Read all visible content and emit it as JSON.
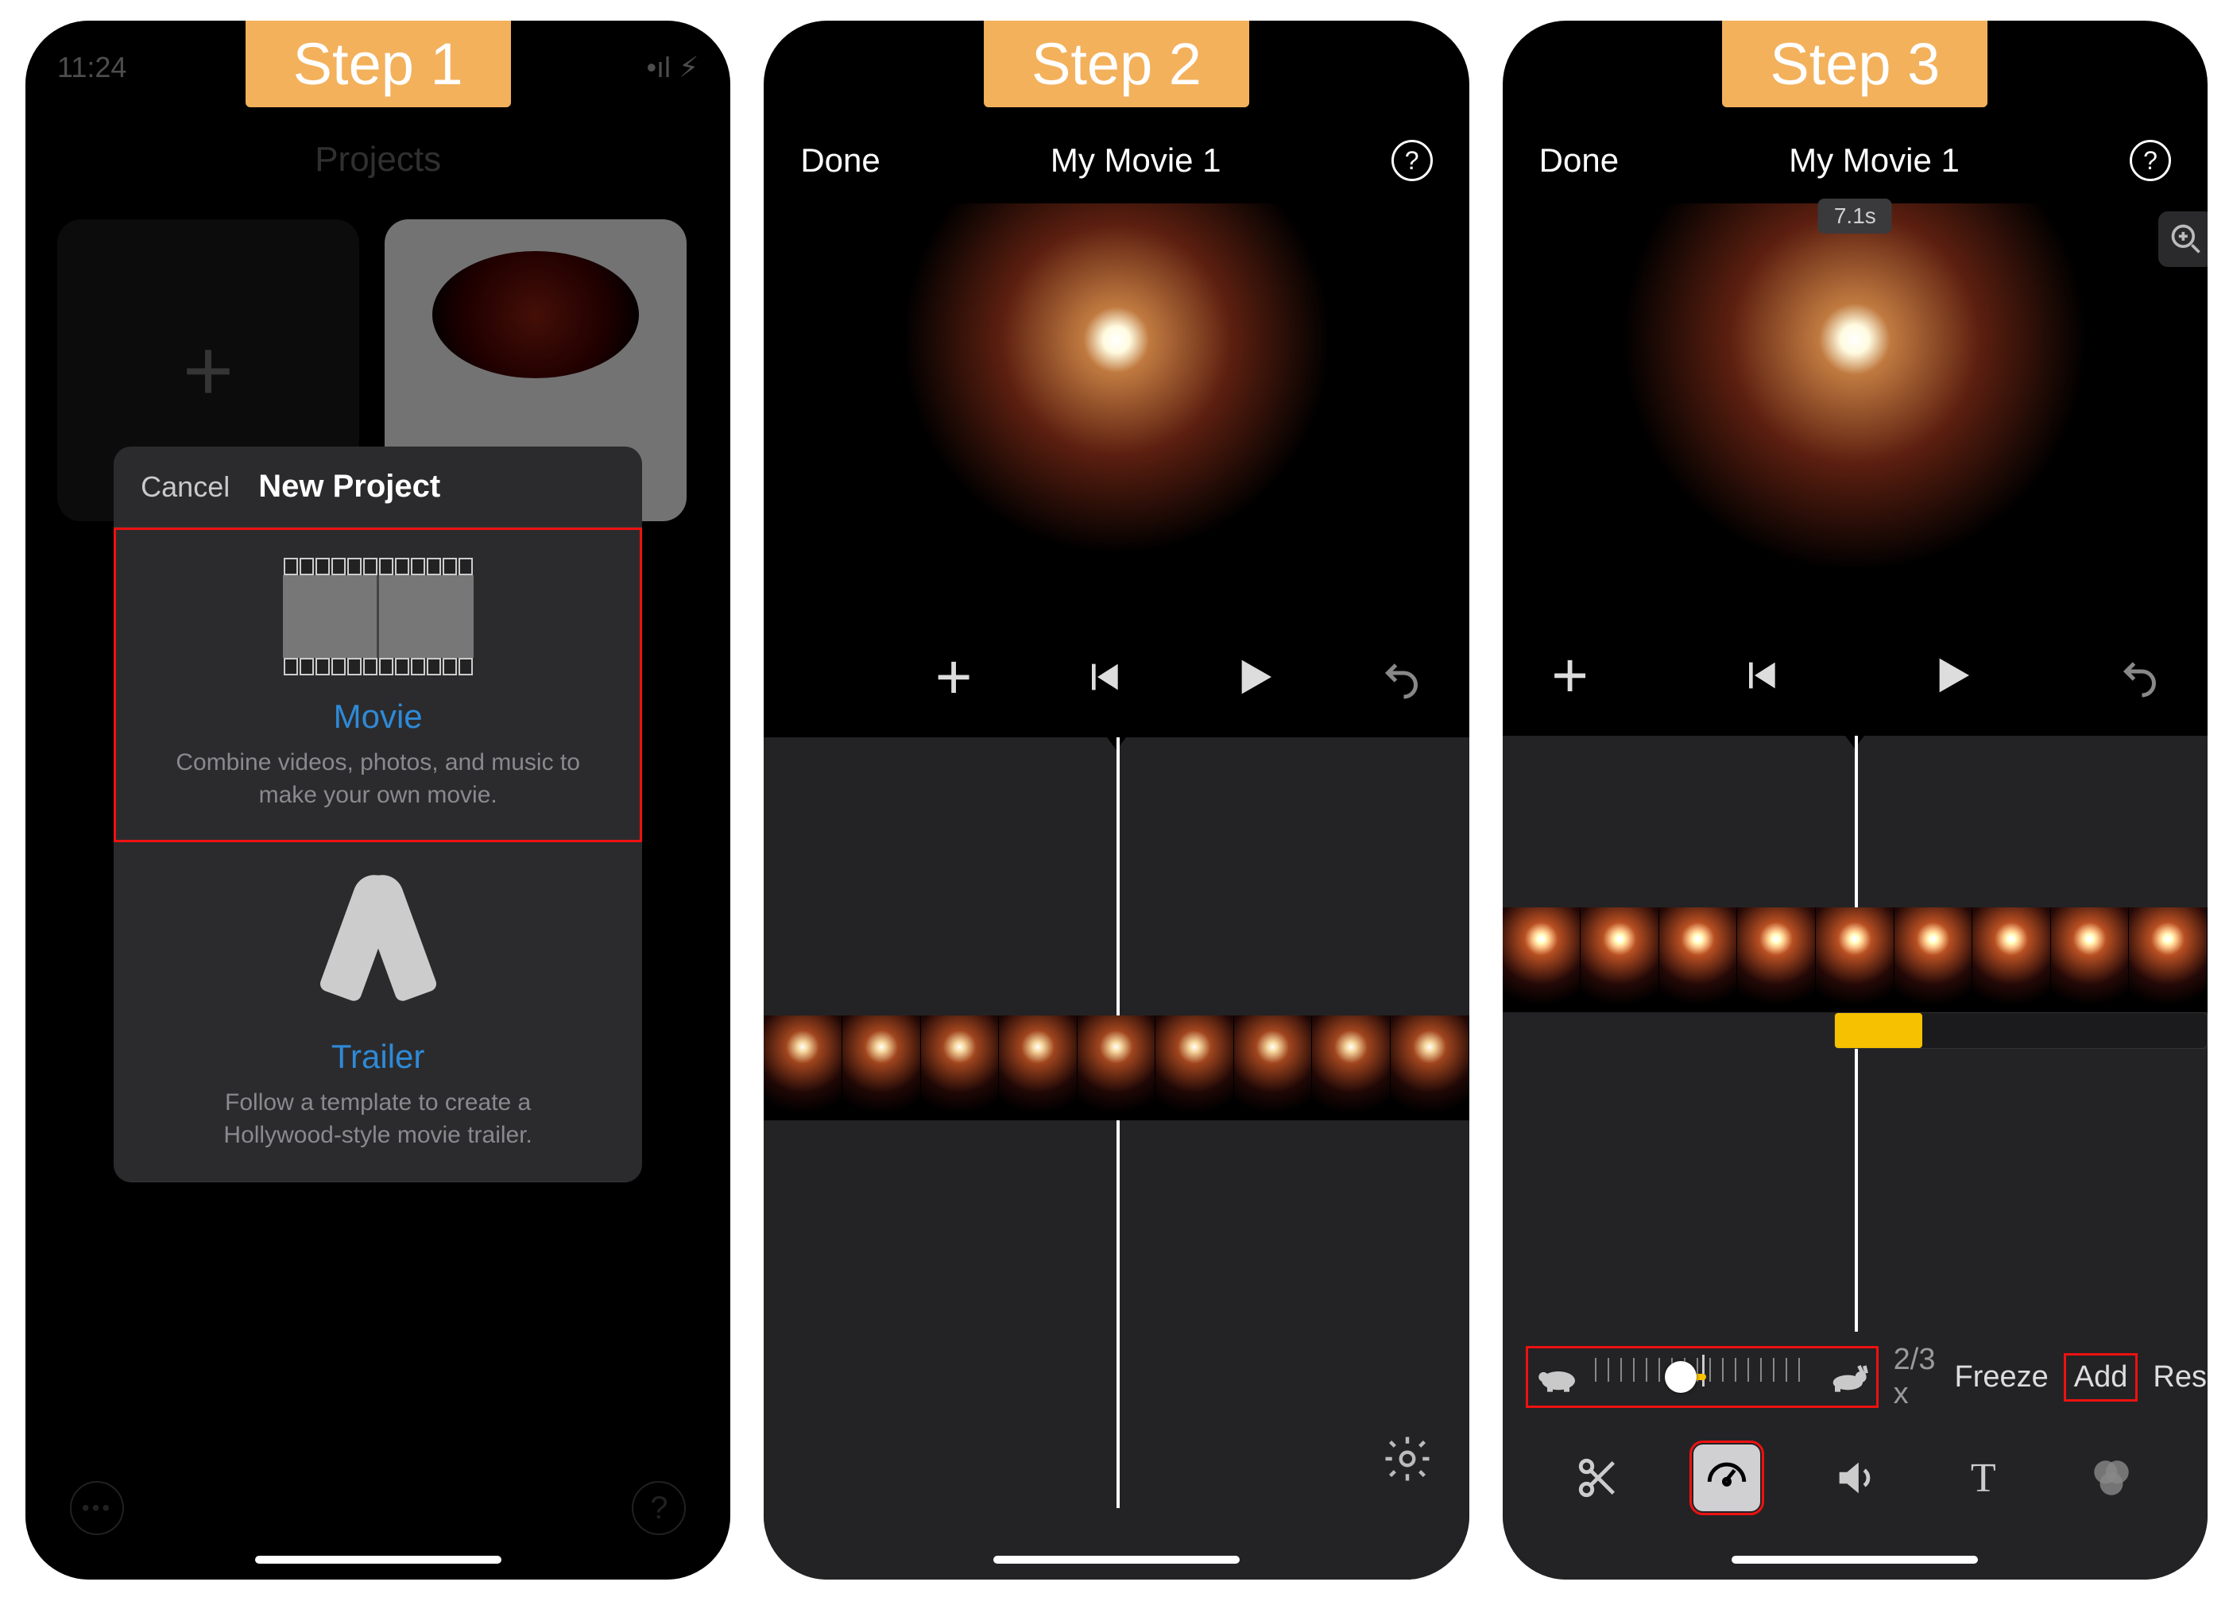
{
  "steps": {
    "s1": "Step 1",
    "s2": "Step 2",
    "s3": "Step 3"
  },
  "step1": {
    "status_time": "11:24",
    "projects_title": "Projects",
    "sheet": {
      "cancel": "Cancel",
      "title": "New Project",
      "movie": {
        "label": "Movie",
        "desc": "Combine videos, photos, and music to make your own movie."
      },
      "trailer": {
        "label": "Trailer",
        "desc": "Follow a template to create a Hollywood-style movie trailer."
      }
    },
    "help_glyph": "?"
  },
  "step2": {
    "done": "Done",
    "title": "My Movie 1",
    "help_glyph": "?"
  },
  "step3": {
    "done": "Done",
    "title": "My Movie 1",
    "help_glyph": "?",
    "time_pill": "7.1s",
    "speed_value": "2/3 x",
    "freeze": "Freeze",
    "add": "Add",
    "reset": "Reset",
    "text_tool_glyph": "T"
  },
  "colors": {
    "badge_bg": "#f3b15c",
    "highlight_red": "#e11",
    "accent_yellow": "#f6c100",
    "link_blue": "#2f8ad6"
  }
}
